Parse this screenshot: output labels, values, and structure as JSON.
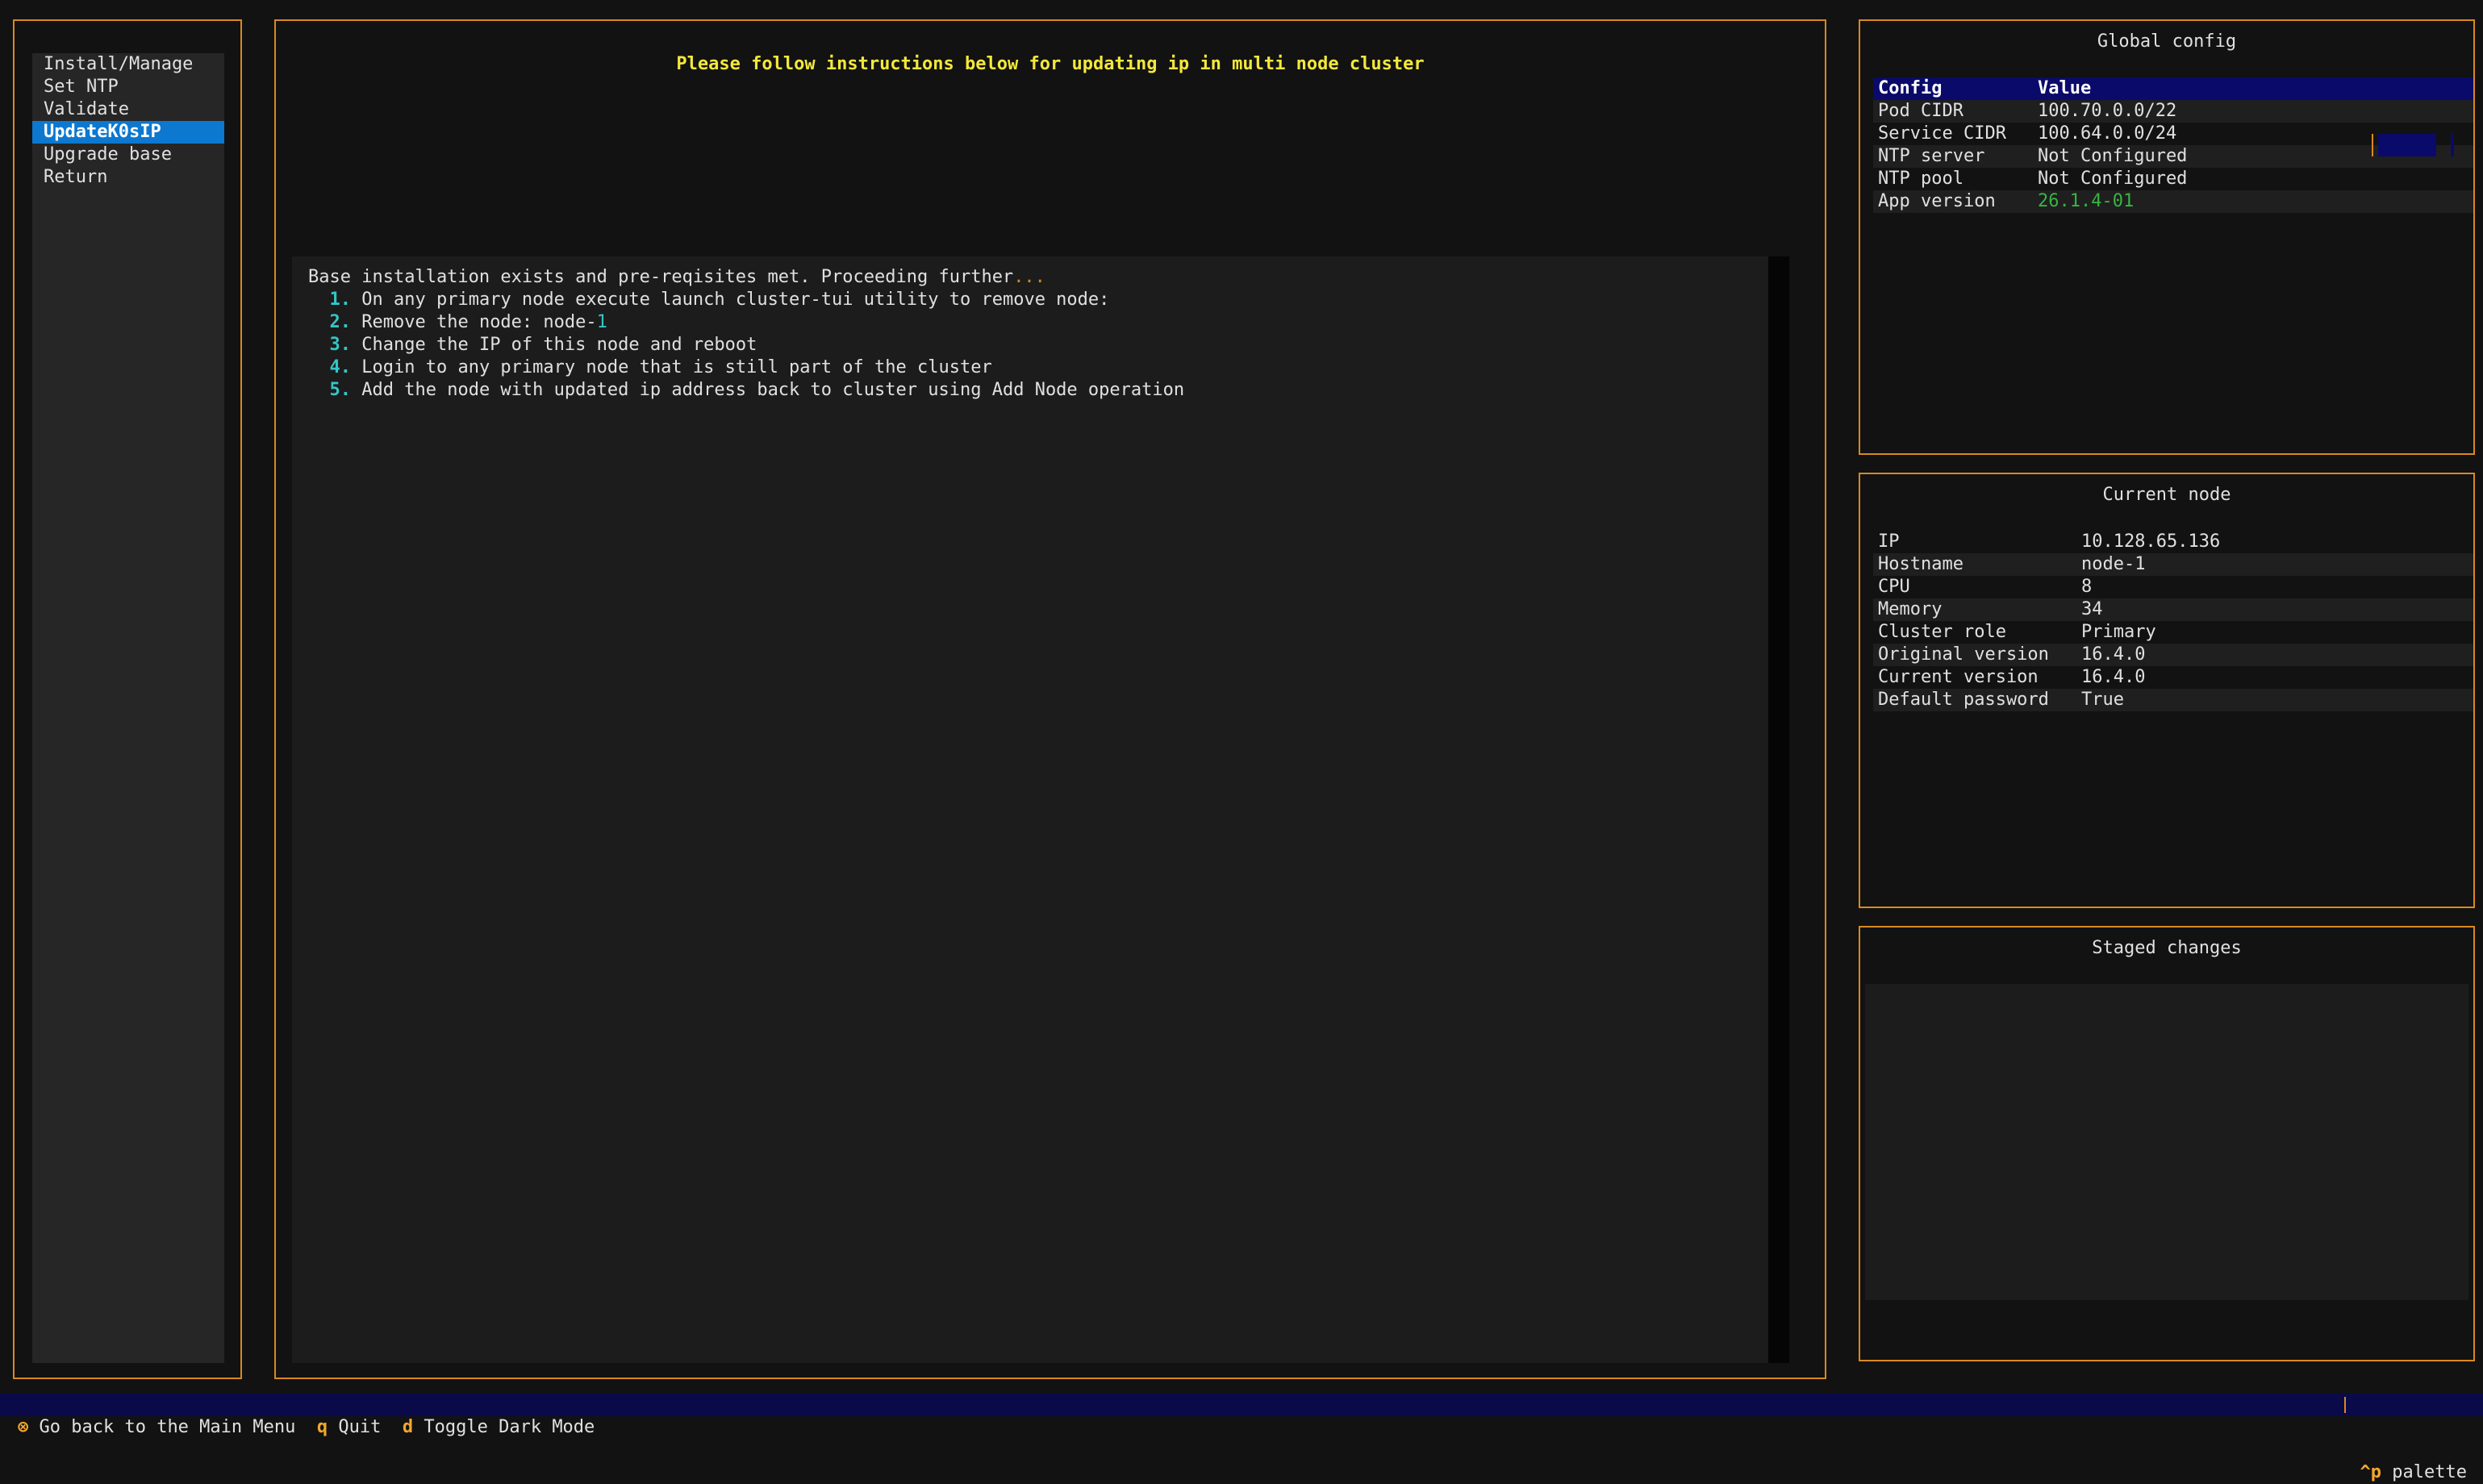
{
  "sidebar": {
    "items": [
      {
        "label": "Install/Manage"
      },
      {
        "label": "Set NTP"
      },
      {
        "label": "Validate"
      },
      {
        "label": "UpdateK0sIP"
      },
      {
        "label": "Upgrade base"
      },
      {
        "label": "Return"
      }
    ],
    "active_index": 3
  },
  "main": {
    "title": "Please follow instructions below for updating ip in multi node cluster",
    "log": {
      "intro": "Base installation exists and pre-reqisites met. Proceeding further",
      "intro_dots": "...",
      "steps": [
        {
          "num": "1.",
          "text": "On any primary node execute launch cluster-tui utility to remove node:"
        },
        {
          "num": "2.",
          "text": "Remove the node: node-",
          "suffix": "1"
        },
        {
          "num": "3.",
          "text": "Change the IP of this node and reboot"
        },
        {
          "num": "4.",
          "text": "Login to any primary node that is still part of the cluster"
        },
        {
          "num": "5.",
          "text": "Add the node with updated ip address back to cluster using Add Node operation"
        }
      ]
    }
  },
  "global_config": {
    "title": "Global config",
    "header": {
      "config": "Config",
      "value": "Value"
    },
    "rows": [
      {
        "key": "Pod CIDR",
        "value": "100.70.0.0/22"
      },
      {
        "key": "Service CIDR",
        "value": "100.64.0.0/24"
      },
      {
        "key": "NTP server",
        "value": "Not Configured"
      },
      {
        "key": "NTP pool",
        "value": "Not Configured"
      },
      {
        "key": "App version",
        "value": "26.1.4-01"
      }
    ],
    "accent_color": "#37b542"
  },
  "current_node": {
    "title": "Current node",
    "rows": [
      {
        "key": "IP",
        "value": "10.128.65.136"
      },
      {
        "key": "Hostname",
        "value": "node-1"
      },
      {
        "key": "CPU",
        "value": "8"
      },
      {
        "key": "Memory",
        "value": "34"
      },
      {
        "key": "Cluster role",
        "value": "Primary"
      },
      {
        "key": "Original version",
        "value": "16.4.0"
      },
      {
        "key": "Current version",
        "value": "16.4.0"
      },
      {
        "key": "Default password",
        "value": "True"
      }
    ]
  },
  "staged_changes": {
    "title": "Staged changes"
  },
  "footer": {
    "bindings": [
      {
        "key": "⊗",
        "label": "Go back to the Main Menu"
      },
      {
        "key": "q",
        "label": "Quit"
      },
      {
        "key": "d",
        "label": "Toggle Dark Mode"
      }
    ],
    "palette": {
      "key": "^p",
      "label": "palette"
    }
  },
  "colors": {
    "border": "#d9891f",
    "title_yellow": "#f3e83b",
    "step_cyan": "#34c6c6",
    "active_blue": "#0d78d0",
    "header_navy": "#0a0a6a"
  }
}
